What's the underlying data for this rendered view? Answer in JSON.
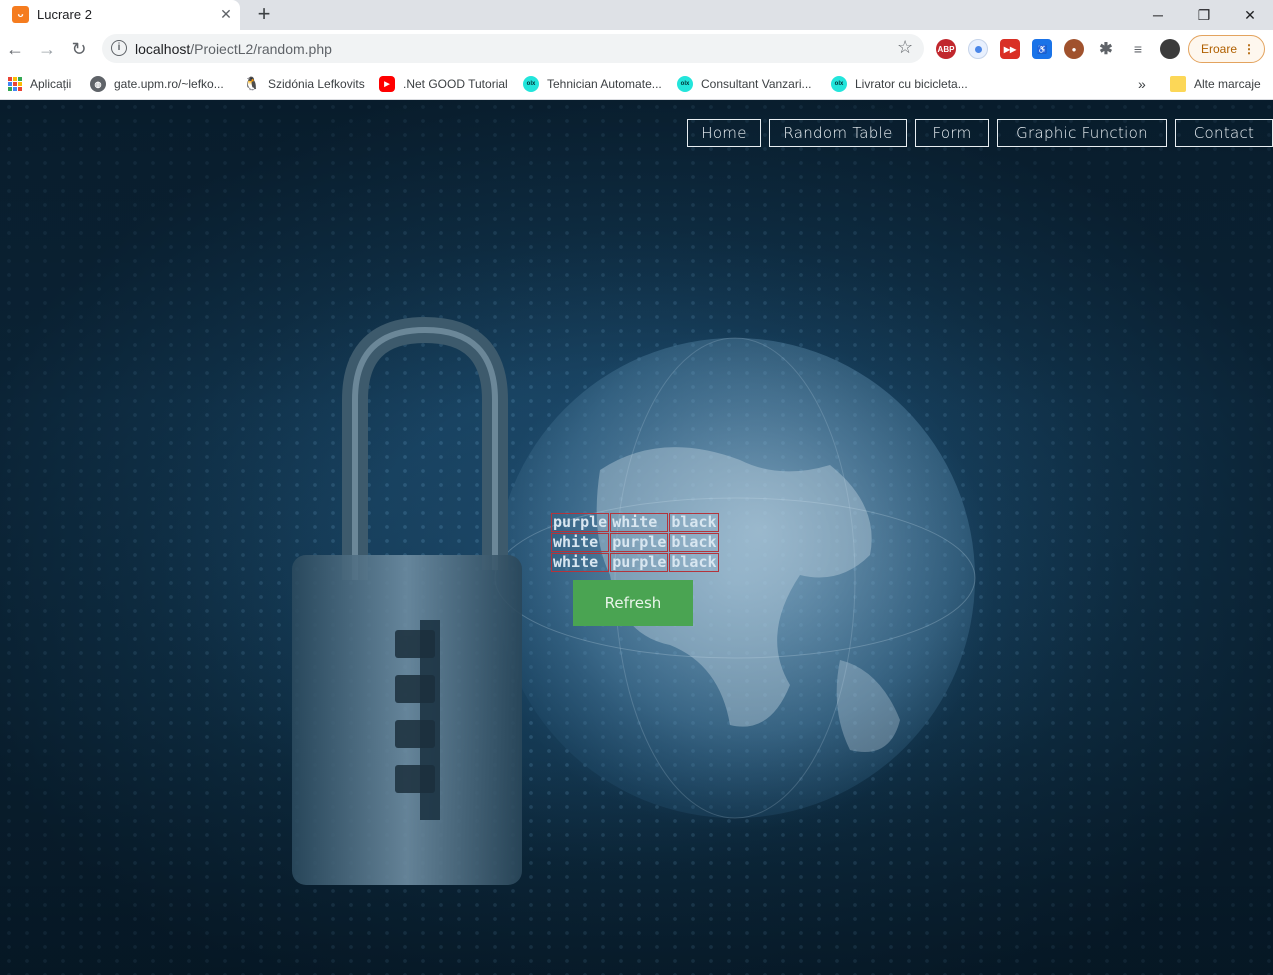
{
  "browser": {
    "tab_title": "Lucrare 2",
    "url_host": "localhost",
    "url_path": "/ProiectL2/random.php",
    "error_label": "Eroare",
    "bookmarks": [
      {
        "label": "Aplicații",
        "icon": "apps-grid-icon"
      },
      {
        "label": "gate.upm.ro/~lefko...",
        "icon": "globe-icon"
      },
      {
        "label": "Szidónia Lefkovits",
        "icon": "linux-tux-icon"
      },
      {
        "label": ".Net GOOD Tutorial",
        "icon": "youtube-icon"
      },
      {
        "label": "Tehnician Automate...",
        "icon": "olx-icon"
      },
      {
        "label": "Consultant Vanzari...",
        "icon": "olx-icon"
      },
      {
        "label": "Livrator cu bicicleta...",
        "icon": "olx-icon"
      }
    ],
    "other_bookmarks": "Alte marcaje",
    "colors": {
      "tab_bg": "#dee1e6",
      "error_accent": "#b06000"
    }
  },
  "page": {
    "topleft_text": "",
    "nav": [
      "Home",
      "Random Table",
      "Form",
      "Graphic Function",
      "Contact"
    ],
    "table": [
      [
        "purple",
        "white",
        "black"
      ],
      [
        "white",
        "purple",
        "black"
      ],
      [
        "white",
        "purple",
        "black"
      ]
    ],
    "refresh_label": "Refresh",
    "colors": {
      "refresh_bg": "#4aa452",
      "cell_border": "#b3343c"
    }
  }
}
